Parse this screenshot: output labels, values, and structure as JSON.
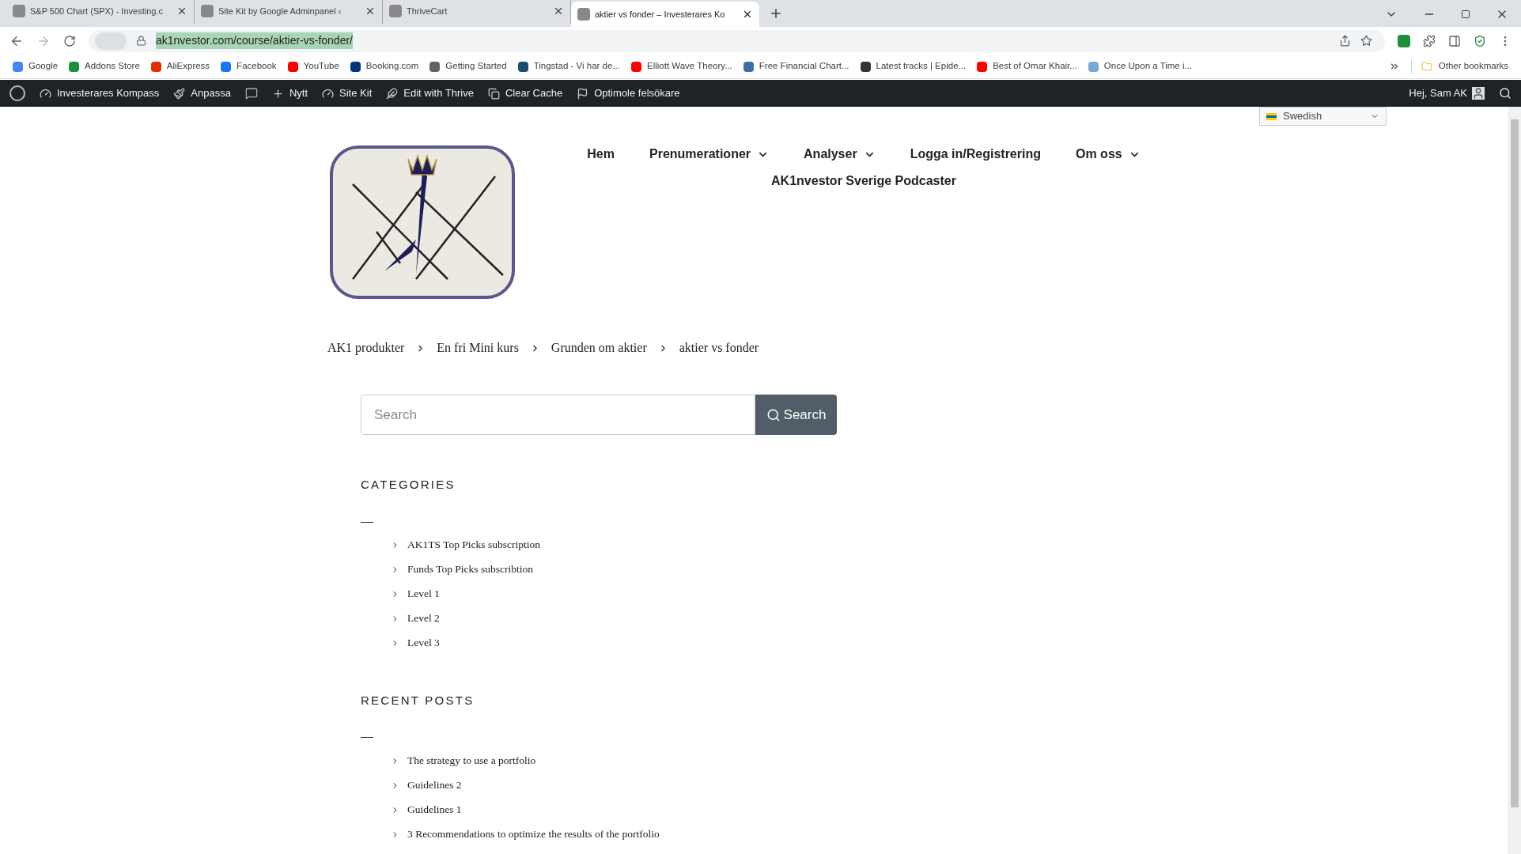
{
  "browser": {
    "tabs": [
      {
        "title": "S&P 500 Chart (SPX) - Investing.c",
        "selected": false
      },
      {
        "title": "Site Kit by Google Adminpanel ‹",
        "selected": false
      },
      {
        "title": "ThriveCart",
        "selected": false
      },
      {
        "title": "aktier vs fonder – Investerares Ko",
        "selected": true
      }
    ],
    "address": "ak1nvestor.com/course/aktier-vs-fonder/",
    "bookmarks": [
      {
        "label": "Google",
        "color": "#4285f4"
      },
      {
        "label": "Addons Store",
        "color": "#1e8e3e"
      },
      {
        "label": "AliExpress",
        "color": "#e62e04"
      },
      {
        "label": "Facebook",
        "color": "#1877f2"
      },
      {
        "label": "YouTube",
        "color": "#ff0000"
      },
      {
        "label": "Booking.com",
        "color": "#003580"
      },
      {
        "label": "Getting Started",
        "color": "#5f6368"
      },
      {
        "label": "Tingstad - Vi har de...",
        "color": "#1d4e6e"
      },
      {
        "label": "Elliott Wave Theory...",
        "color": "#ff0000"
      },
      {
        "label": "Free Financial Chart...",
        "color": "#3a6ea5"
      },
      {
        "label": "Latest tracks | Epide...",
        "color": "#333333"
      },
      {
        "label": "Best of Omar Khair...",
        "color": "#ff0000"
      },
      {
        "label": "Once Upon a Time i...",
        "color": "#7aa6d8"
      }
    ],
    "other_bookmarks": "Other bookmarks"
  },
  "admin_bar": {
    "items": [
      "Investerares Kompass",
      "Anpassa",
      "Nytt",
      "Site Kit",
      "Edit with Thrive",
      "Clear Cache",
      "Optimole felsökare"
    ],
    "greeting": "Hej, Sam AK"
  },
  "site": {
    "language": "Swedish",
    "nav": [
      {
        "label": "Hem",
        "dropdown": false
      },
      {
        "label": "Prenumerationer",
        "dropdown": true
      },
      {
        "label": "Analyser",
        "dropdown": true
      },
      {
        "label": "Logga in/Registrering",
        "dropdown": false
      },
      {
        "label": "Om oss",
        "dropdown": true
      },
      {
        "label": "AK1nvestor Sverige Podcaster",
        "dropdown": false
      }
    ],
    "breadcrumb": [
      "AK1 produkter",
      "En fri Mini kurs",
      "Grunden om aktier",
      "aktier vs fonder"
    ],
    "search": {
      "placeholder": "Search",
      "button": "Search"
    },
    "widgets": [
      {
        "title": "CATEGORIES",
        "items": [
          "AK1TS Top Picks subscription",
          "Funds Top Picks subscribtion",
          "Level 1",
          "Level 2",
          "Level 3"
        ]
      },
      {
        "title": "RECENT POSTS",
        "items": [
          "The strategy to use a portfolio",
          "Guidelines 2",
          "Guidelines 1",
          "3 Recommendations to optimize the results of the portfolio"
        ]
      }
    ]
  }
}
